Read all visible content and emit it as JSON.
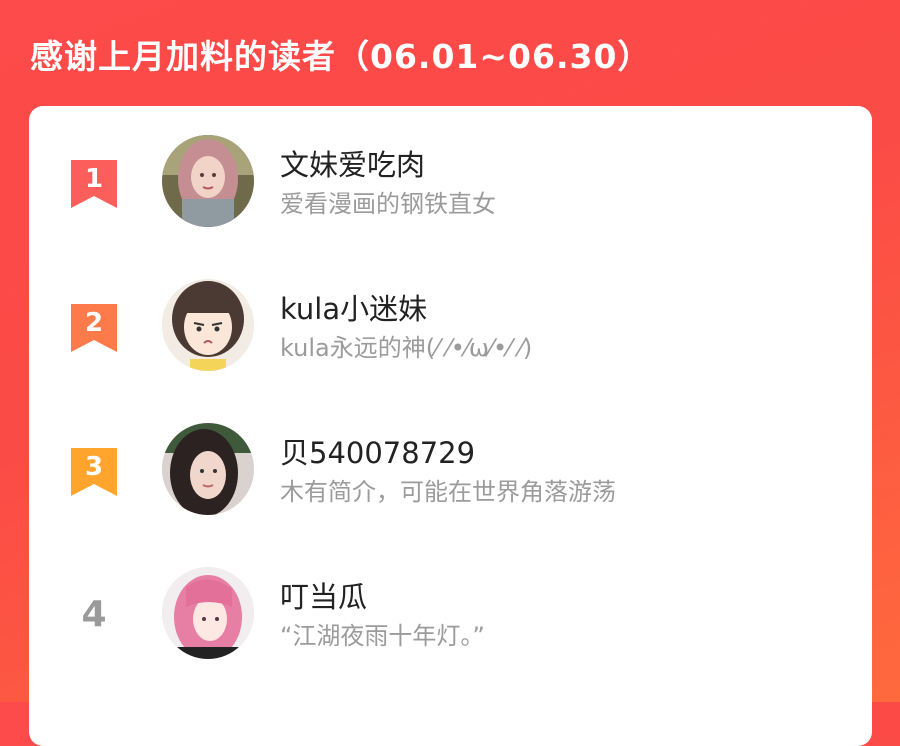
{
  "header": {
    "title": "感谢上月加料的读者（06.01~06.30）"
  },
  "colors": {
    "background_red": "#fb4b46",
    "rank1": "#fc5e5c",
    "rank2": "#fd7a4a",
    "rank3": "#ffa42c",
    "rank_plain": "#9a9a9a"
  },
  "readers": [
    {
      "rank": "1",
      "name": "文妹爱吃肉",
      "bio": "爱看漫画的钢铁直女",
      "avatar": "woman-pink-hair-photo"
    },
    {
      "rank": "2",
      "name": "kula小迷妹",
      "bio": "kula永远的神(⁄ ⁄•⁄ω⁄•⁄ ⁄)",
      "avatar": "cartoon-girl-avatar"
    },
    {
      "rank": "3",
      "name": "贝540078729",
      "bio": "木有简介，可能在世界角落游荡",
      "avatar": "woman-selfie-photo"
    },
    {
      "rank": "4",
      "name": "叮当瓜",
      "bio": "“江湖夜雨十年灯。”",
      "avatar": "anime-pink-hair-avatar"
    }
  ]
}
